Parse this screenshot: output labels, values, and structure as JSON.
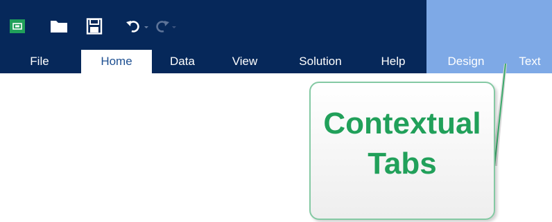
{
  "quick_access": {
    "icons": [
      "app-logo-icon",
      "open-folder-icon",
      "save-icon",
      "undo-icon",
      "redo-icon"
    ]
  },
  "tabs": [
    {
      "label": "File",
      "active": false
    },
    {
      "label": "Home",
      "active": true
    },
    {
      "label": "Data",
      "active": false
    },
    {
      "label": "View",
      "active": false
    },
    {
      "label": "Solution",
      "active": false
    },
    {
      "label": "Help",
      "active": false
    }
  ],
  "contextual_tabs": [
    {
      "label": "Design"
    },
    {
      "label": "Text"
    }
  ],
  "callout": {
    "line1": "Contextual",
    "line2": "Tabs"
  },
  "colors": {
    "ribbon": "#06285a",
    "contextual": "#7ea9e6",
    "callout_text": "#21a05a",
    "callout_border": "#84c9a3",
    "active_tab_text": "#1d4f91"
  }
}
